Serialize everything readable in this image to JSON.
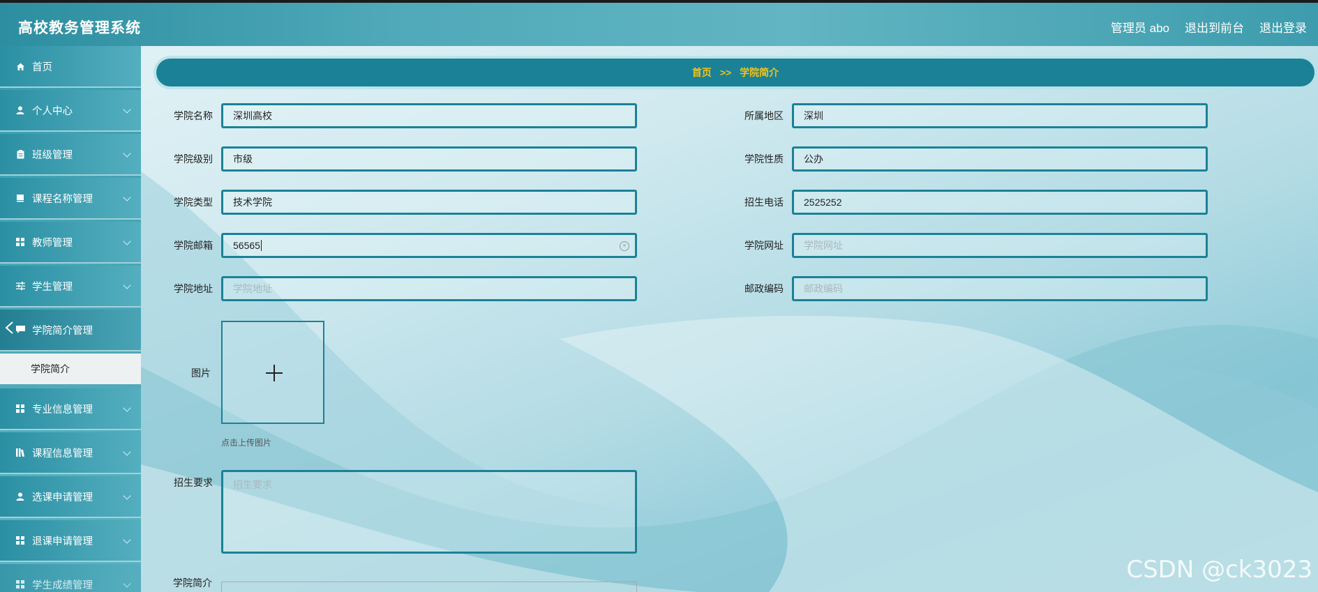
{
  "header": {
    "title": "高校教务管理系统",
    "admin": "管理员 abo",
    "to_front": "退出到前台",
    "logout": "退出登录"
  },
  "sidebar": {
    "items": [
      {
        "label": "首页",
        "icon": "home-icon"
      },
      {
        "label": "个人中心",
        "icon": "user-icon"
      },
      {
        "label": "班级管理",
        "icon": "clipboard-icon"
      },
      {
        "label": "课程名称管理",
        "icon": "book-icon"
      },
      {
        "label": "教师管理",
        "icon": "grid-icon"
      },
      {
        "label": "学生管理",
        "icon": "sliders-icon"
      },
      {
        "label": "学院简介管理",
        "icon": "chat-icon"
      },
      {
        "label": "专业信息管理",
        "icon": "grid-icon"
      },
      {
        "label": "课程信息管理",
        "icon": "bars-icon"
      },
      {
        "label": "选课申请管理",
        "icon": "user-icon"
      },
      {
        "label": "退课申请管理",
        "icon": "grid-icon"
      },
      {
        "label": "学生成绩管理",
        "icon": "grid-icon"
      }
    ],
    "sub_active": "学院简介"
  },
  "breadcrumb": {
    "home": "首页",
    "sep": ">>",
    "current": "学院简介"
  },
  "form": {
    "name": {
      "label": "学院名称",
      "value": "深圳高校"
    },
    "region": {
      "label": "所属地区",
      "value": "深圳"
    },
    "level": {
      "label": "学院级别",
      "value": "市级"
    },
    "nature": {
      "label": "学院性质",
      "value": "公办"
    },
    "type": {
      "label": "学院类型",
      "value": "技术学院"
    },
    "phone": {
      "label": "招生电话",
      "value": "2525252"
    },
    "email": {
      "label": "学院邮箱",
      "value": "56565"
    },
    "website": {
      "label": "学院网址",
      "placeholder": "学院网址"
    },
    "address": {
      "label": "学院地址",
      "placeholder": "学院地址"
    },
    "postcode": {
      "label": "邮政编码",
      "placeholder": "邮政编码"
    },
    "image": {
      "label": "图片",
      "hint": "点击上传图片"
    },
    "requirements": {
      "label": "招生要求",
      "placeholder": "招生要求"
    },
    "intro": {
      "label": "学院简介"
    }
  },
  "watermark": "CSDN @ck3023",
  "colors": {
    "accent": "#1b8196",
    "breadcrumb_text": "#f3c21b",
    "header": "#4fa9b8"
  }
}
